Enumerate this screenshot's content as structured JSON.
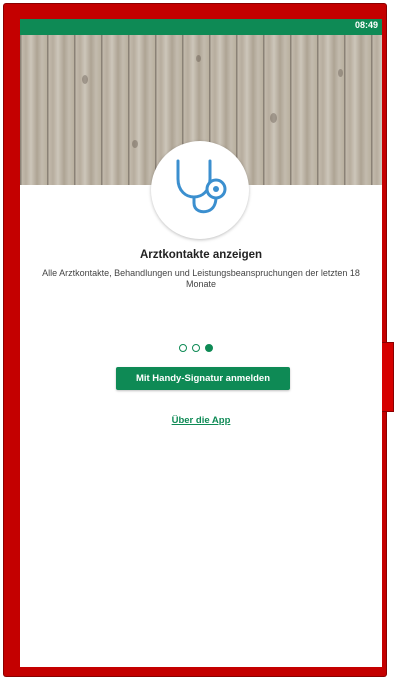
{
  "status_bar": {
    "time": "08:49"
  },
  "onboarding": {
    "icon": "stethoscope-icon",
    "title": "Arztkontakte anzeigen",
    "description": "Alle Arztkontakte, Behandlungen und Leistungsbeanspruchungen der letzten 18 Monate",
    "pages_total": 3,
    "current_page": 3
  },
  "actions": {
    "login_label": "Mit Handy-Signatur anmelden",
    "about_label": "Über die App"
  },
  "colors": {
    "accent": "#0e8a55",
    "frame": "#c40000",
    "icon_blue": "#3b8fcf"
  }
}
